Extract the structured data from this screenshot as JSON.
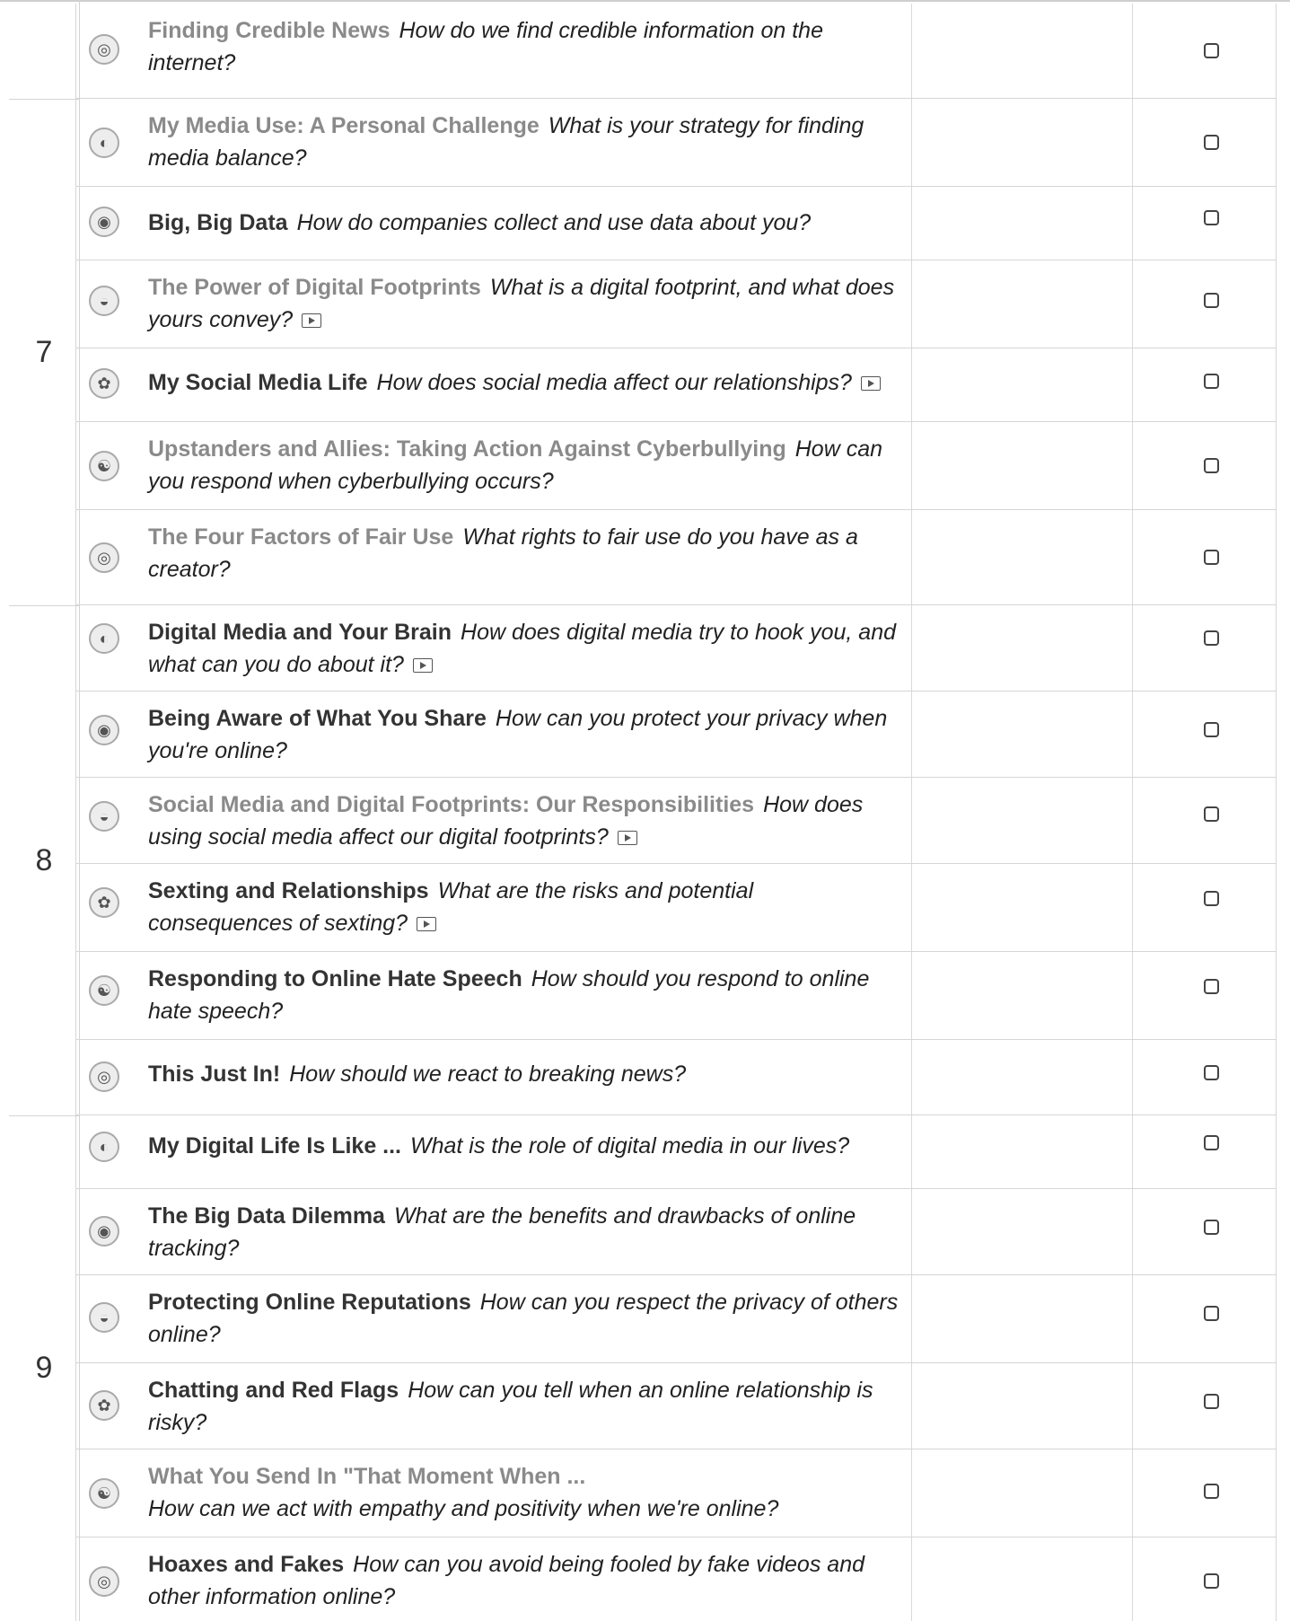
{
  "grades": [
    {
      "label": "7"
    },
    {
      "label": "8"
    },
    {
      "label": "9"
    }
  ],
  "rows": [
    {
      "grade": "",
      "icon": "news-globe-icon",
      "glyph": "◎",
      "title": "Finding Credible News",
      "question": "How do we find credible information on the internet?",
      "video": false,
      "title_style": "gray"
    },
    {
      "grade": "7",
      "icon": "media-balance-icon",
      "glyph": "◐",
      "title": "My Media Use: A Personal Challenge",
      "question": "What is your strategy for finding media balance?",
      "video": false,
      "title_style": "gray"
    },
    {
      "grade": "7",
      "icon": "privacy-icon",
      "glyph": "◉",
      "title": "Big, Big Data",
      "question": "How do companies collect and use data about you?",
      "video": false,
      "title_style": "dark"
    },
    {
      "grade": "7",
      "icon": "footprint-icon",
      "glyph": "◒",
      "title": "The Power of Digital Footprints",
      "question": "What is a digital footprint, and what does yours convey?",
      "video": true,
      "title_style": "gray"
    },
    {
      "grade": "7",
      "icon": "relationships-icon",
      "glyph": "✿",
      "title": "My Social Media Life",
      "question": "How does social media affect our relationships?",
      "video": true,
      "title_style": "dark"
    },
    {
      "grade": "7",
      "icon": "cyberbullying-icon",
      "glyph": "☯",
      "title": "Upstanders and Allies: Taking Action Against Cyberbullying",
      "question": "How can you respond when cyberbullying occurs?",
      "video": false,
      "title_style": "gray"
    },
    {
      "grade": "7",
      "icon": "news-globe-icon",
      "glyph": "◎",
      "title": "The Four Factors of Fair Use",
      "question": "What rights to fair use do you have as a creator?",
      "video": false,
      "title_style": "gray"
    },
    {
      "grade": "8",
      "icon": "media-balance-icon",
      "glyph": "◐",
      "title": "Digital Media and Your Brain",
      "question": "How does digital media try to hook you, and what can you do about it?",
      "video": true,
      "title_style": "dark"
    },
    {
      "grade": "8",
      "icon": "privacy-icon",
      "glyph": "◉",
      "title": "Being Aware of What You Share",
      "question": "How can you protect your privacy when you're online?",
      "video": false,
      "title_style": "dark"
    },
    {
      "grade": "8",
      "icon": "footprint-icon",
      "glyph": "◒",
      "title": "Social Media and Digital Footprints: Our Responsibilities",
      "question": "How does using social media affect our digital footprints?",
      "video": true,
      "title_style": "gray"
    },
    {
      "grade": "8",
      "icon": "relationships-icon",
      "glyph": "✿",
      "title": "Sexting and Relationships",
      "question": "What are the risks and potential consequences of sexting?",
      "video": true,
      "title_style": "dark"
    },
    {
      "grade": "8",
      "icon": "cyberbullying-icon",
      "glyph": "☯",
      "title": "Responding to Online Hate Speech",
      "question": "How should you respond to online hate speech?",
      "video": false,
      "title_style": "dark"
    },
    {
      "grade": "8",
      "icon": "news-globe-icon",
      "glyph": "◎",
      "title": "This Just In!",
      "question": "How should we react to breaking news?",
      "video": false,
      "title_style": "dark"
    },
    {
      "grade": "9",
      "icon": "media-balance-icon",
      "glyph": "◐",
      "title": "My Digital Life Is Like ...",
      "question": "What is the role of digital media in our lives?",
      "video": false,
      "title_style": "dark"
    },
    {
      "grade": "9",
      "icon": "privacy-icon",
      "glyph": "◉",
      "title": "The Big Data Dilemma",
      "question": "What are the benefits and drawbacks of online tracking?",
      "video": false,
      "title_style": "dark"
    },
    {
      "grade": "9",
      "icon": "footprint-icon",
      "glyph": "◒",
      "title": "Protecting Online Reputations",
      "question": "How can you respect the privacy of others online?",
      "video": false,
      "title_style": "dark"
    },
    {
      "grade": "9",
      "icon": "relationships-icon",
      "glyph": "✿",
      "title": "Chatting and Red Flags",
      "question": "How can you tell when an online relationship is risky?",
      "video": false,
      "title_style": "dark"
    },
    {
      "grade": "9",
      "icon": "cyberbullying-icon",
      "glyph": "☯",
      "title": "What You Send In \"That Moment When ...",
      "question": "How can we act with empathy and positivity when we're online?",
      "video": false,
      "title_style": "gray"
    },
    {
      "grade": "9",
      "icon": "news-globe-icon",
      "glyph": "◎",
      "title": "Hoaxes and Fakes",
      "question": "How can you avoid being fooled by fake videos and other information online?",
      "video": false,
      "title_style": "dark"
    }
  ]
}
